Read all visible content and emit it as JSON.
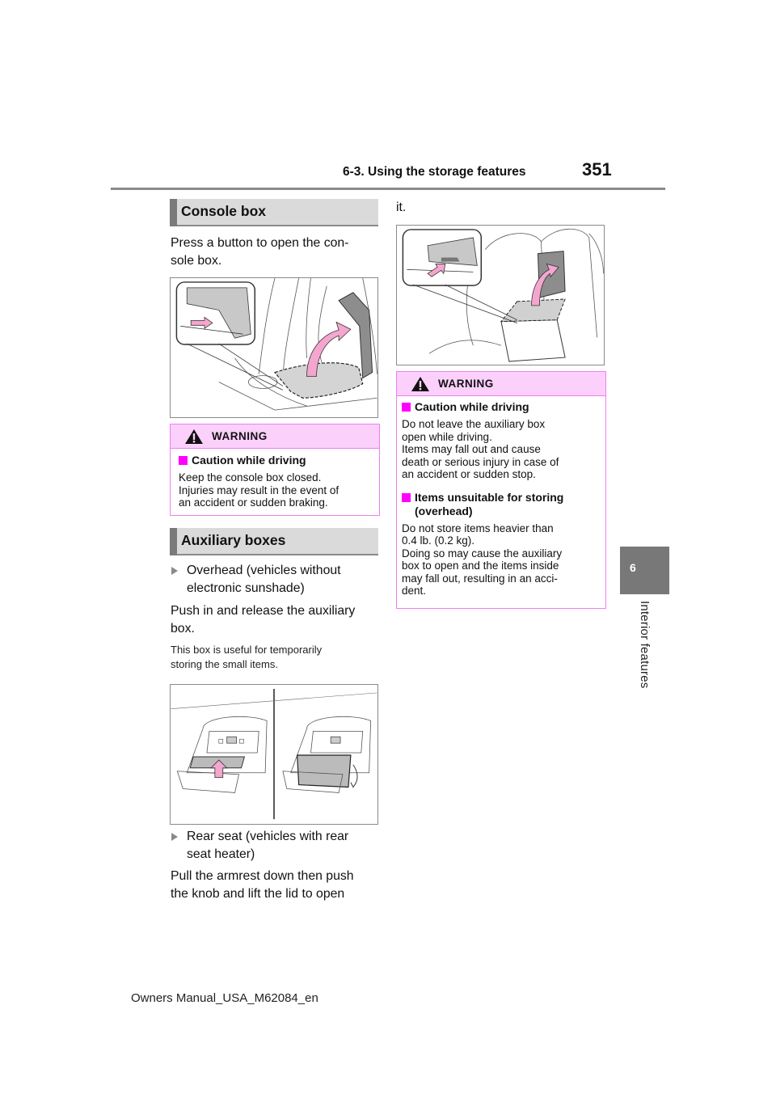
{
  "header": {
    "section_title": "6-3. Using the storage features",
    "page_number": "351"
  },
  "side_tab": {
    "chapter_number": "6",
    "chapter_title": "Interior features"
  },
  "left_column": {
    "console_box": {
      "heading": "Console box",
      "paragraph": "Press a button to open the con-sole box.",
      "paragraph_lines": [
        "Press a button to open the con-",
        "sole box."
      ],
      "figure": {
        "icon": "console-box-illustration",
        "description": "Console box lid being opened with inset showing button press"
      },
      "warning": {
        "title": "WARNING",
        "icon": "warning-triangle-icon",
        "items": [
          {
            "heading": "Caution while driving",
            "lines": [
              "Keep the console box closed.",
              "Injuries may result in the event of",
              "an accident or sudden braking."
            ]
          }
        ]
      }
    },
    "auxiliary_boxes": {
      "heading": "Auxiliary boxes",
      "overhead": {
        "bullet_lines": [
          "Overhead (vehicles without",
          "electronic sunshade)"
        ],
        "instruction_lines": [
          "Push in and release the auxiliary",
          "box."
        ],
        "note_lines": [
          "This box is useful for temporarily",
          "storing the small items."
        ],
        "figure": {
          "icon": "overhead-auxiliary-box-illustration",
          "description": "Overhead auxiliary box closed and opened"
        }
      },
      "rear_seat": {
        "bullet_lines": [
          "Rear seat (vehicles with rear",
          "seat heater)"
        ],
        "instruction_lines": [
          "Pull the armrest down then push",
          "the knob and lift the lid to open"
        ]
      }
    }
  },
  "right_column": {
    "continued_text": "it.",
    "figure": {
      "icon": "rear-armrest-box-illustration",
      "description": "Rear armrest auxiliary box lid being lifted with inset showing knob"
    },
    "warning": {
      "title": "WARNING",
      "icon": "warning-triangle-icon",
      "items": [
        {
          "heading_lines": [
            "Caution while driving"
          ],
          "lines": [
            "Do not leave the auxiliary box",
            "open while driving.",
            "Items may fall out and cause",
            "death or serious injury in case of",
            "an accident or sudden stop."
          ]
        },
        {
          "heading_lines": [
            "Items unsuitable for storing",
            "(overhead)"
          ],
          "lines": [
            "Do not store items heavier than",
            "0.4 lb. (0.2 kg).",
            "Doing so may cause the auxiliary",
            "box to open and the items inside",
            "may fall out, resulting in an acci-",
            "dent."
          ]
        }
      ]
    }
  },
  "footer": {
    "manual_id": "Owners Manual_USA_M62084_en"
  },
  "colors": {
    "warning_border": "#f07ef0",
    "warning_header_bg": "#fbd0fb",
    "warning_bullet": "#ff00ff",
    "section_header_bg": "#dadada",
    "side_tab_bg": "#787878",
    "arrow_pink": "#f4a6cf"
  }
}
